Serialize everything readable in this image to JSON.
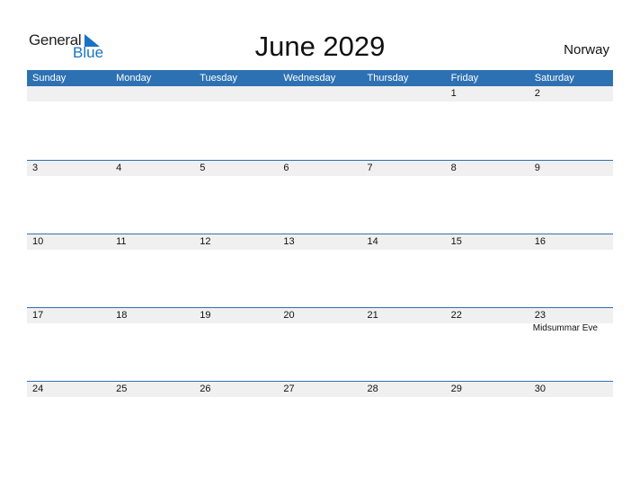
{
  "logo": {
    "general": "General",
    "blue": "Blue"
  },
  "title": "June 2029",
  "country": "Norway",
  "weekdays": [
    "Sunday",
    "Monday",
    "Tuesday",
    "Wednesday",
    "Thursday",
    "Friday",
    "Saturday"
  ],
  "weeks": [
    {
      "days": [
        "",
        "",
        "",
        "",
        "",
        "1",
        "2"
      ],
      "holidays": [
        "",
        "",
        "",
        "",
        "",
        "",
        ""
      ]
    },
    {
      "days": [
        "3",
        "4",
        "5",
        "6",
        "7",
        "8",
        "9"
      ],
      "holidays": [
        "",
        "",
        "",
        "",
        "",
        "",
        ""
      ]
    },
    {
      "days": [
        "10",
        "11",
        "12",
        "13",
        "14",
        "15",
        "16"
      ],
      "holidays": [
        "",
        "",
        "",
        "",
        "",
        "",
        ""
      ]
    },
    {
      "days": [
        "17",
        "18",
        "19",
        "20",
        "21",
        "22",
        "23"
      ],
      "holidays": [
        "",
        "",
        "",
        "",
        "",
        "",
        "Midsummar Eve"
      ]
    },
    {
      "days": [
        "24",
        "25",
        "26",
        "27",
        "28",
        "29",
        "30"
      ],
      "holidays": [
        "",
        "",
        "",
        "",
        "",
        "",
        ""
      ]
    }
  ],
  "colors": {
    "accent": "#2e71b3",
    "row_bg": "#f0f0f0",
    "logo_blue": "#1a73c2"
  }
}
